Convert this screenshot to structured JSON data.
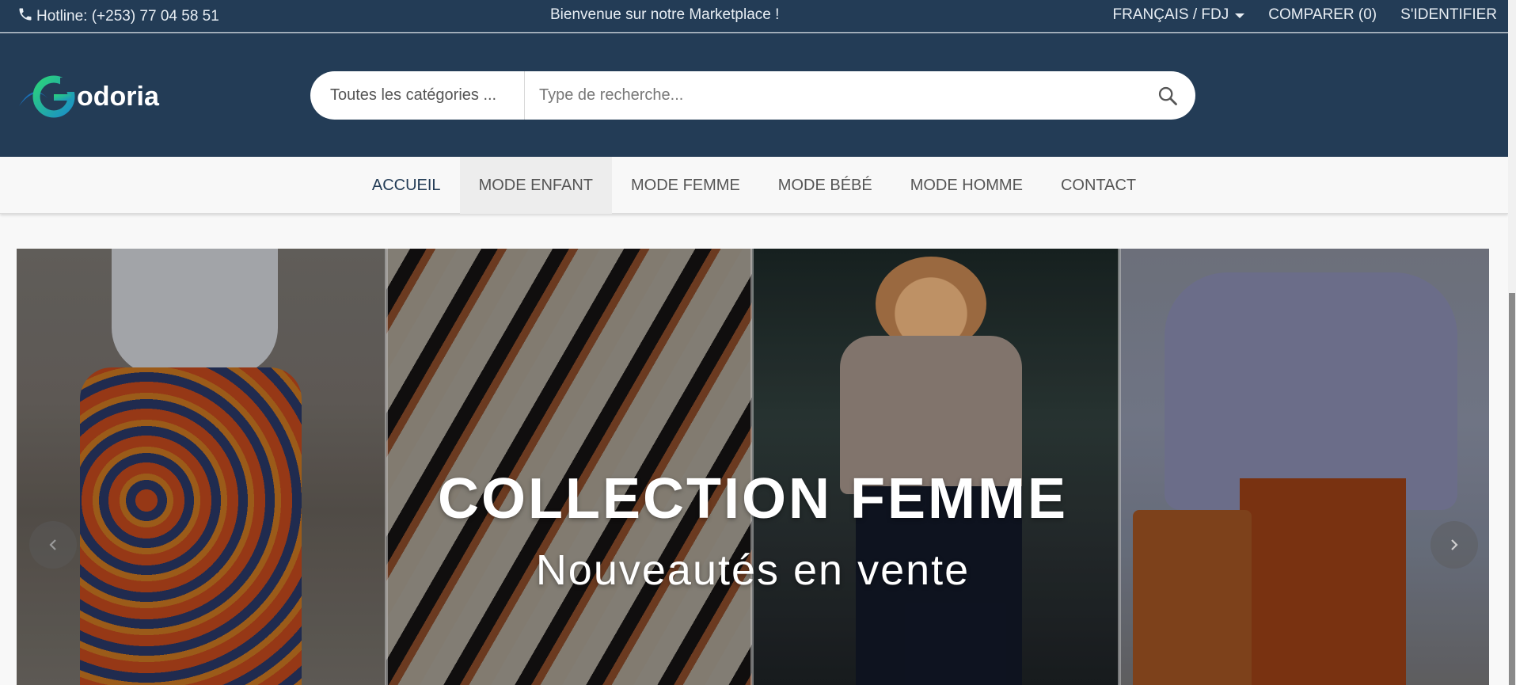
{
  "topbar": {
    "hotline": "Hotline: (+253) 77 04 58 51",
    "welcome": "Bienvenue sur notre Marketplace !",
    "language": "FRANÇAIS / FDJ",
    "compare": "COMPARER (0)",
    "login": "S'IDENTIFIER"
  },
  "header": {
    "logo_text": "odoria",
    "search": {
      "category": "Toutes les catégories ...",
      "placeholder": "Type de recherche..."
    }
  },
  "nav": {
    "items": [
      {
        "label": "ACCUEIL"
      },
      {
        "label": "MODE ENFANT"
      },
      {
        "label": "MODE FEMME"
      },
      {
        "label": "MODE BÉBÉ"
      },
      {
        "label": "MODE HOMME"
      },
      {
        "label": "CONTACT"
      }
    ]
  },
  "hero": {
    "title": "COLLECTION FEMME",
    "subtitle": "Nouveautés en vente"
  },
  "colors": {
    "header_bg": "#233c56",
    "nav_bg": "#f8f8f8",
    "accent_green": "#2bbf6f"
  },
  "icons": {
    "phone": "phone-icon",
    "caret": "caret-down-icon",
    "search": "search-icon",
    "prev": "chevron-left-icon",
    "next": "chevron-right-icon"
  }
}
